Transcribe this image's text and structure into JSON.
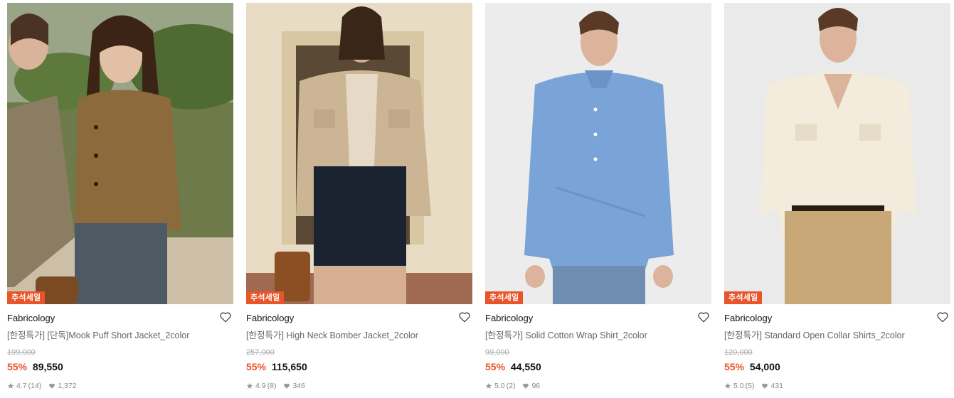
{
  "products": [
    {
      "badge": "추석세일",
      "brand": "Fabricology",
      "title": "[한정특가] [단독]Mook Puff Short Jacket_2color",
      "original_price": "199,000",
      "discount": "55%",
      "price": "89,550",
      "rating": "4.7",
      "review_count": "(14)",
      "likes": "1,372"
    },
    {
      "badge": "추석세일",
      "brand": "Fabricology",
      "title": "[한정특가] High Neck Bomber Jacket_2color",
      "original_price": "257,000",
      "discount": "55%",
      "price": "115,650",
      "rating": "4.9",
      "review_count": "(8)",
      "likes": "346"
    },
    {
      "badge": "추석세일",
      "brand": "Fabricology",
      "title": "[한정특가] Solid Cotton Wrap Shirt_2color",
      "original_price": "99,000",
      "discount": "55%",
      "price": "44,550",
      "rating": "5.0",
      "review_count": "(2)",
      "likes": "96"
    },
    {
      "badge": "추석세일",
      "brand": "Fabricology",
      "title": "[한정특가] Standard Open Collar Shirts_2color",
      "original_price": "120,000",
      "discount": "55%",
      "price": "54,000",
      "rating": "5.0",
      "review_count": "(5)",
      "likes": "431"
    }
  ],
  "icons": {
    "wishlist": "heart-outline-icon",
    "rating": "star-icon",
    "likes": "heart-filled-icon"
  },
  "colors": {
    "accent": "#e8552a",
    "muted_text": "#888888",
    "strikethrough": "#aaaaaa"
  }
}
